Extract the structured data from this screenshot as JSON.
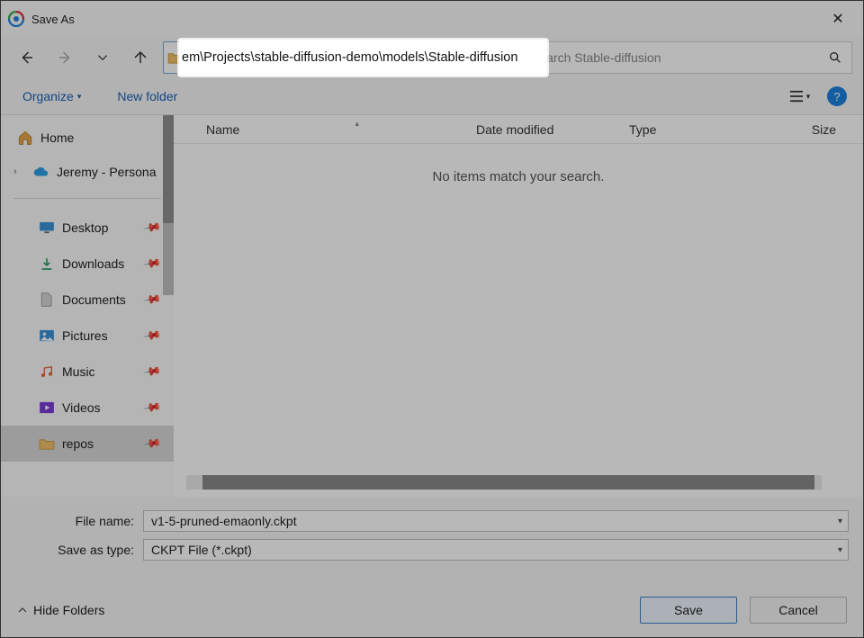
{
  "window": {
    "title": "Save As"
  },
  "address": {
    "path_visible": "em\\Projects\\stable-diffusion-demo\\models\\Stable-diffusion"
  },
  "search": {
    "placeholder": "Search Stable-diffusion"
  },
  "toolbar": {
    "organize": "Organize",
    "new_folder": "New folder",
    "help": "?"
  },
  "sidebar": {
    "home": "Home",
    "personal": "Jeremy - Persona",
    "quick": [
      {
        "label": "Desktop",
        "icon": "desktop"
      },
      {
        "label": "Downloads",
        "icon": "downloads"
      },
      {
        "label": "Documents",
        "icon": "documents"
      },
      {
        "label": "Pictures",
        "icon": "pictures"
      },
      {
        "label": "Music",
        "icon": "music"
      },
      {
        "label": "Videos",
        "icon": "videos"
      },
      {
        "label": "repos",
        "icon": "folder",
        "selected": true
      }
    ]
  },
  "columns": {
    "name": "Name",
    "date": "Date modified",
    "type": "Type",
    "size": "Size"
  },
  "list": {
    "empty": "No items match your search."
  },
  "form": {
    "file_name_label": "File name:",
    "file_name_value": "v1-5-pruned-emaonly.ckpt",
    "type_label": "Save as type:",
    "type_value": "CKPT File (*.ckpt)"
  },
  "footer": {
    "hide_folders": "Hide Folders",
    "save": "Save",
    "cancel": "Cancel"
  }
}
